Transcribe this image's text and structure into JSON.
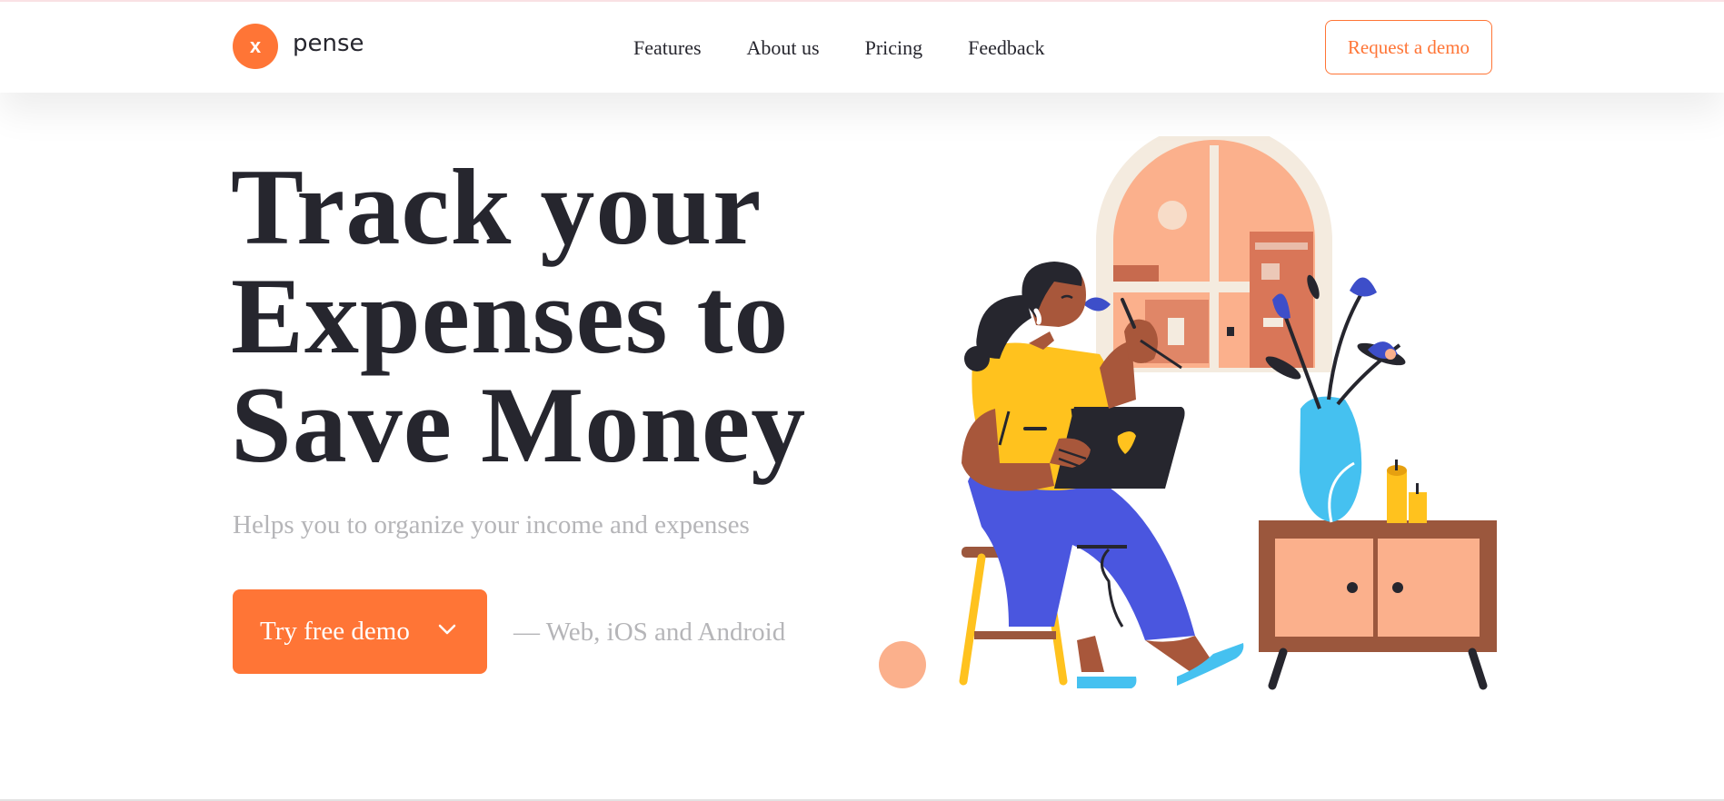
{
  "brand": {
    "logo_letter": "x",
    "name": "pense",
    "accent_color": "#ff7536"
  },
  "nav": {
    "items": [
      {
        "label": "Features"
      },
      {
        "label": "About us"
      },
      {
        "label": "Pricing"
      },
      {
        "label": "Feedback"
      }
    ],
    "request_demo_label": "Request a demo"
  },
  "hero": {
    "title_lines": [
      "Track your",
      "Expenses to",
      "Save Money"
    ],
    "subtitle": "Helps you to organize your income and expenses",
    "cta_label": "Try free demo",
    "cta_icon": "chevron-down-icon",
    "platforms_text": "— Web, iOS and Android"
  },
  "illustration": {
    "subject": "woman-with-laptop-on-stool-illustration"
  }
}
